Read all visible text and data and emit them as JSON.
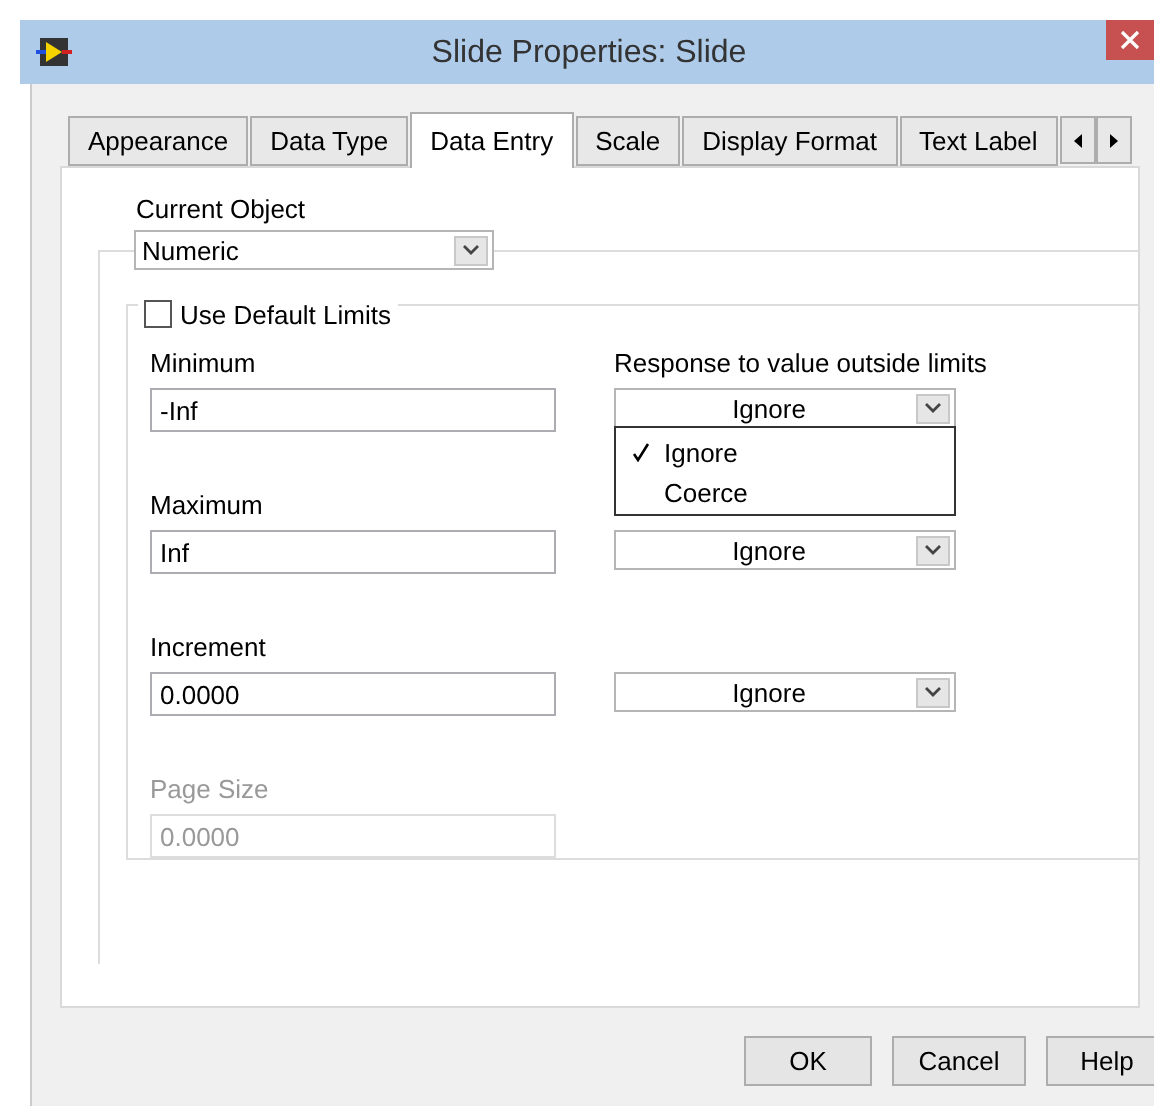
{
  "window": {
    "title": "Slide Properties: Slide"
  },
  "tabs": [
    {
      "label": "Appearance",
      "selected": false
    },
    {
      "label": "Data Type",
      "selected": false
    },
    {
      "label": "Data Entry",
      "selected": true
    },
    {
      "label": "Scale",
      "selected": false
    },
    {
      "label": "Display Format",
      "selected": false
    },
    {
      "label": "Text Label",
      "selected": false
    }
  ],
  "current_object": {
    "label": "Current Object",
    "value": "Numeric"
  },
  "limits_group": {
    "label": "Use Default Limits",
    "checked": false
  },
  "response_header": "Response to value outside limits",
  "fields": [
    {
      "label": "Minimum",
      "value": "-Inf",
      "disabled": false,
      "response": "Ignore",
      "menu_open": true
    },
    {
      "label": "Maximum",
      "value": "Inf",
      "disabled": false,
      "response": "Ignore",
      "menu_open": false
    },
    {
      "label": "Increment",
      "value": "0.0000",
      "disabled": false,
      "response": "Ignore",
      "menu_open": false
    },
    {
      "label": "Page Size",
      "value": "0.0000",
      "disabled": true
    }
  ],
  "response_menu": [
    {
      "label": "Ignore",
      "selected": true
    },
    {
      "label": "Coerce",
      "selected": false
    }
  ],
  "buttons": [
    "OK",
    "Cancel",
    "Help"
  ]
}
